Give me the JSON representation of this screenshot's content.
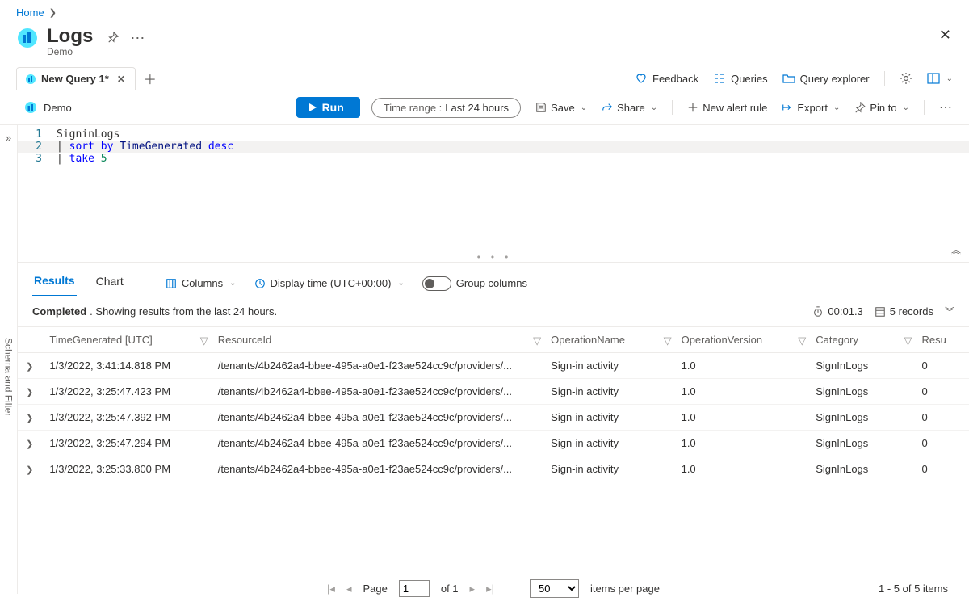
{
  "breadcrumb": {
    "home": "Home"
  },
  "header": {
    "title": "Logs",
    "subtitle": "Demo"
  },
  "tabs": {
    "active": "New Query 1*"
  },
  "toplinks": {
    "feedback": "Feedback",
    "queries": "Queries",
    "explorer": "Query explorer"
  },
  "toolbar": {
    "scope": "Demo",
    "run": "Run",
    "timerange_label": "Time range :",
    "timerange_value": "Last 24 hours",
    "save": "Save",
    "share": "Share",
    "newalert": "New alert rule",
    "export": "Export",
    "pin": "Pin to"
  },
  "sidebar": {
    "label": "Schema and Filter"
  },
  "editor": {
    "lines": [
      {
        "n": "1",
        "text": "SigninLogs",
        "tok": "tbl"
      },
      {
        "n": "2",
        "raw": "| sort by TimeGenerated desc"
      },
      {
        "n": "3",
        "raw": "| take 5"
      }
    ]
  },
  "results": {
    "tabs": {
      "results": "Results",
      "chart": "Chart"
    },
    "columns_btn": "Columns",
    "displaytime": "Display time (UTC+00:00)",
    "groupcols": "Group columns",
    "status_bold": "Completed",
    "status_rest": ". Showing results from the last 24 hours.",
    "elapsed": "00:01.3",
    "recordcount": "5 records",
    "headers": {
      "time": "TimeGenerated [UTC]",
      "resource": "ResourceId",
      "op": "OperationName",
      "ver": "OperationVersion",
      "cat": "Category",
      "last": "Resu"
    },
    "rows": [
      {
        "time": "1/3/2022, 3:41:14.818 PM",
        "resource": "/tenants/4b2462a4-bbee-495a-a0e1-f23ae524cc9c/providers/...",
        "op": "Sign-in activity",
        "ver": "1.0",
        "cat": "SignInLogs",
        "last": "0"
      },
      {
        "time": "1/3/2022, 3:25:47.423 PM",
        "resource": "/tenants/4b2462a4-bbee-495a-a0e1-f23ae524cc9c/providers/...",
        "op": "Sign-in activity",
        "ver": "1.0",
        "cat": "SignInLogs",
        "last": "0"
      },
      {
        "time": "1/3/2022, 3:25:47.392 PM",
        "resource": "/tenants/4b2462a4-bbee-495a-a0e1-f23ae524cc9c/providers/...",
        "op": "Sign-in activity",
        "ver": "1.0",
        "cat": "SignInLogs",
        "last": "0"
      },
      {
        "time": "1/3/2022, 3:25:47.294 PM",
        "resource": "/tenants/4b2462a4-bbee-495a-a0e1-f23ae524cc9c/providers/...",
        "op": "Sign-in activity",
        "ver": "1.0",
        "cat": "SignInLogs",
        "last": "0"
      },
      {
        "time": "1/3/2022, 3:25:33.800 PM",
        "resource": "/tenants/4b2462a4-bbee-495a-a0e1-f23ae524cc9c/providers/...",
        "op": "Sign-in activity",
        "ver": "1.0",
        "cat": "SignInLogs",
        "last": "0"
      }
    ]
  },
  "pager": {
    "page_label": "Page",
    "page_value": "1",
    "of_label": "of 1",
    "pagesize": "50",
    "pagesize_label": "items per page",
    "summary": "1 - 5 of 5 items"
  }
}
